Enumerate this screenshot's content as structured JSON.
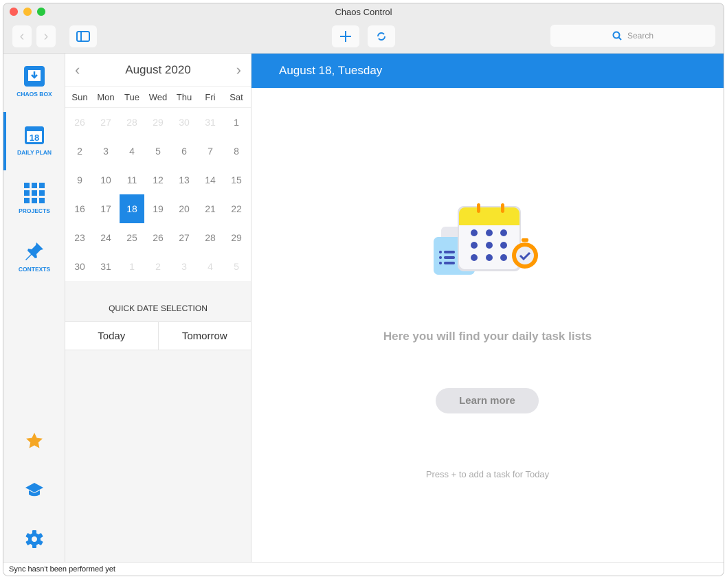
{
  "window": {
    "title": "Chaos Control"
  },
  "toolbar": {
    "search_placeholder": "Search"
  },
  "nav": {
    "items": [
      {
        "label": "CHAOS BOX",
        "icon": "inbox-icon"
      },
      {
        "label": "DAILY PLAN",
        "icon": "calendar-icon",
        "active": true
      },
      {
        "label": "PROJECTS",
        "icon": "grid-icon"
      },
      {
        "label": "CONTEXTS",
        "icon": "pin-icon"
      }
    ],
    "bottom_icons": [
      "star-icon",
      "graduation-cap-icon",
      "gear-icon"
    ]
  },
  "calendar": {
    "month_label": "August 2020",
    "weekdays": [
      "Sun",
      "Mon",
      "Tue",
      "Wed",
      "Thu",
      "Fri",
      "Sat"
    ],
    "days": [
      "26",
      "27",
      "28",
      "29",
      "30",
      "31",
      "1",
      "2",
      "3",
      "4",
      "5",
      "6",
      "7",
      "8",
      "9",
      "10",
      "11",
      "12",
      "13",
      "14",
      "15",
      "16",
      "17",
      "18",
      "19",
      "20",
      "21",
      "22",
      "23",
      "24",
      "25",
      "26",
      "27",
      "28",
      "29",
      "30",
      "31",
      "1",
      "2",
      "3",
      "4",
      "5"
    ],
    "selected": "18",
    "quick_title": "QUICK DATE SELECTION",
    "today": "Today",
    "tomorrow": "Tomorrow"
  },
  "main": {
    "header": "August 18, Tuesday",
    "message": "Here you will find your daily task lists",
    "learn_more": "Learn more",
    "hint": "Press + to add a task for Today"
  },
  "status": "Sync hasn't been performed yet",
  "colors": {
    "accent": "#1e88e5",
    "star": "#f5a623"
  }
}
